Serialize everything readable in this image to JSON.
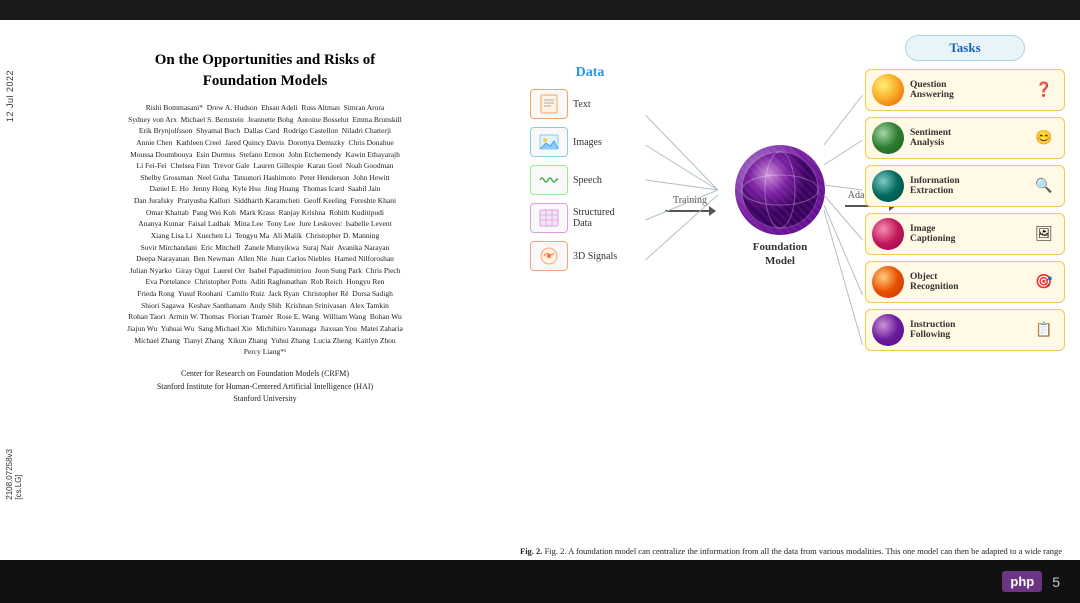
{
  "paper": {
    "title_line1": "On the Opportunities and Risks of",
    "title_line2": "Foundation Models",
    "authors": "Rishi Bommasani*  Drew A. Hudson  Ehsan Adeli  Russ Altman  Simran Arora\nSydney von Arx  Michael S. Bernstein  Jeannette Bohg  Antoine Bosselut  Emma Brunskill\nErik Brynjolfsson  Shyamal Buch  Dallas Card  Rodrigo Castellon  Niladri Chatterji\nAnnie Chen  Kathleen Creel  Jared Quincy Davis  Dorottya Demszky  Chris Donahue\nMoussa Doumbouya  Esin Durmus  Stefano Ermon  John Etchemendy  Kawin Ethayarajh\nLi Fei-Fei  Chelsea Finn  Trevor Gale  Lauren Gillespie  Karan Goel  Noah Goodman\nShelby Grossman  Neel Guha  Tatsunori Hashimoto  Peter Henderson  John Hewitt\nDaniel E. Ho  Jenny Hong  Kyle Hsu  Jing Huang  Thomas Icard  Saahil Jain\nDan Jurafsky  Pratyusha Kalluri  Siddharth Karamcheti  Geoff Keeling  Fereshte Khani\nOmar Khattab  Pang Wei Koh  Mark Krass  Ranjay Krishna  Rohith Kuditipudi\nAnanya Kumar  Faisal Ladhak  Mina Lee  Tony Lee  Jure Leskovec  Isabelle Levent\nXiang Lisa Li  Xuechen Li  Tengyu Ma  Ali Malik  Christopher D. Manning\nSuvir Mirchandani  Eric Mitchell  Zanele Munyikwa  Suraj Nair  Avanika Narayan\nDeepa Narayanan  Ben Newman  Allen Nie  Juan Carlos Niebles  Hamed Nilforoshan\nJulian Nyarko  Giray Ogut  Laurel Orr  Isabel Papadimitriou  Joon Sung Park  Chris Piech\nEva Portelance  Christopher Potts  Aditi Raghunathan  Rob Reich  Hongyu Ren\nFrieda Rong  Yusuf Roohani  Camilo Ruiz  Jack Ryan  Christopher Ré  Dorsa Sadigh\nShiori Sagawa  Keshav Santhanam  Andy Shih  Krishnan Srinivasan  Alex Tamkin\nRohan Taori  Armin W. Thomas  Florian Tramèr  Rose E. Wang  William Wang  Bohan Wu\nJiajun Wu  Yuhuai Wu  Sang Michael Xie  Michihiro Yasunaga  Jiaxuan You  Matei Zaharia\nMichael Zhang  Tianyi Zhang  Xikun Zhang  Yuhui Zhang  Lucia Zheng  Kaitlyn Zhou\nPercy Liang*¹",
    "institution1": "Center for Research on Foundation Models (CRFM)",
    "institution2": "Stanford Institute for Human-Centered Artificial Intelligence (HAI)",
    "institution3": "Stanford University"
  },
  "diagram": {
    "data_label": "Data",
    "data_items": [
      {
        "label": "Text",
        "icon": "📄"
      },
      {
        "label": "Images",
        "icon": "🖼"
      },
      {
        "label": "Speech",
        "icon": "🎤"
      },
      {
        "label": "Structured\nData",
        "icon": "📊"
      },
      {
        "label": "3D Signals",
        "icon": "📡"
      }
    ],
    "training_label": "Training",
    "foundation_model_label": "Foundation\nModel",
    "adaptation_label": "Adaptation",
    "tasks_label": "Tasks",
    "tasks": [
      {
        "label": "Question\nAnswering",
        "sphere_class": "sphere-yellow",
        "icon": "❓"
      },
      {
        "label": "Sentiment\nAnalysis",
        "sphere_class": "sphere-green",
        "icon": "😊"
      },
      {
        "label": "Information\nExtraction",
        "sphere_class": "sphere-teal",
        "icon": "🔍"
      },
      {
        "label": "Image\nCaptioning",
        "sphere_class": "sphere-pink",
        "icon": "🖼"
      },
      {
        "label": "Object\nRecognition",
        "sphere_class": "sphere-orange",
        "icon": "🎯"
      },
      {
        "label": "Instruction\nFollowing",
        "sphere_class": "sphere-purple",
        "icon": "📋"
      }
    ],
    "caption": "Fig. 2.  A foundation model can centralize the information from all the data from various modalities. This one model can then be adapted to a wide range of downstream tasks."
  },
  "meta": {
    "date_label": "12 Jul 2022",
    "arxiv_label": "[cs.LG]",
    "arxiv_id": "2108.07258v3",
    "slide_number": "5",
    "php_label": "php"
  }
}
